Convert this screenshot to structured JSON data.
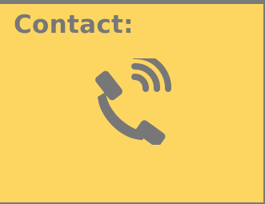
{
  "card": {
    "title": "Contact:",
    "icon": "phone-ringing-icon"
  },
  "colors": {
    "background": "#fdd662",
    "text": "#777777",
    "border": "#7a7a7a"
  }
}
